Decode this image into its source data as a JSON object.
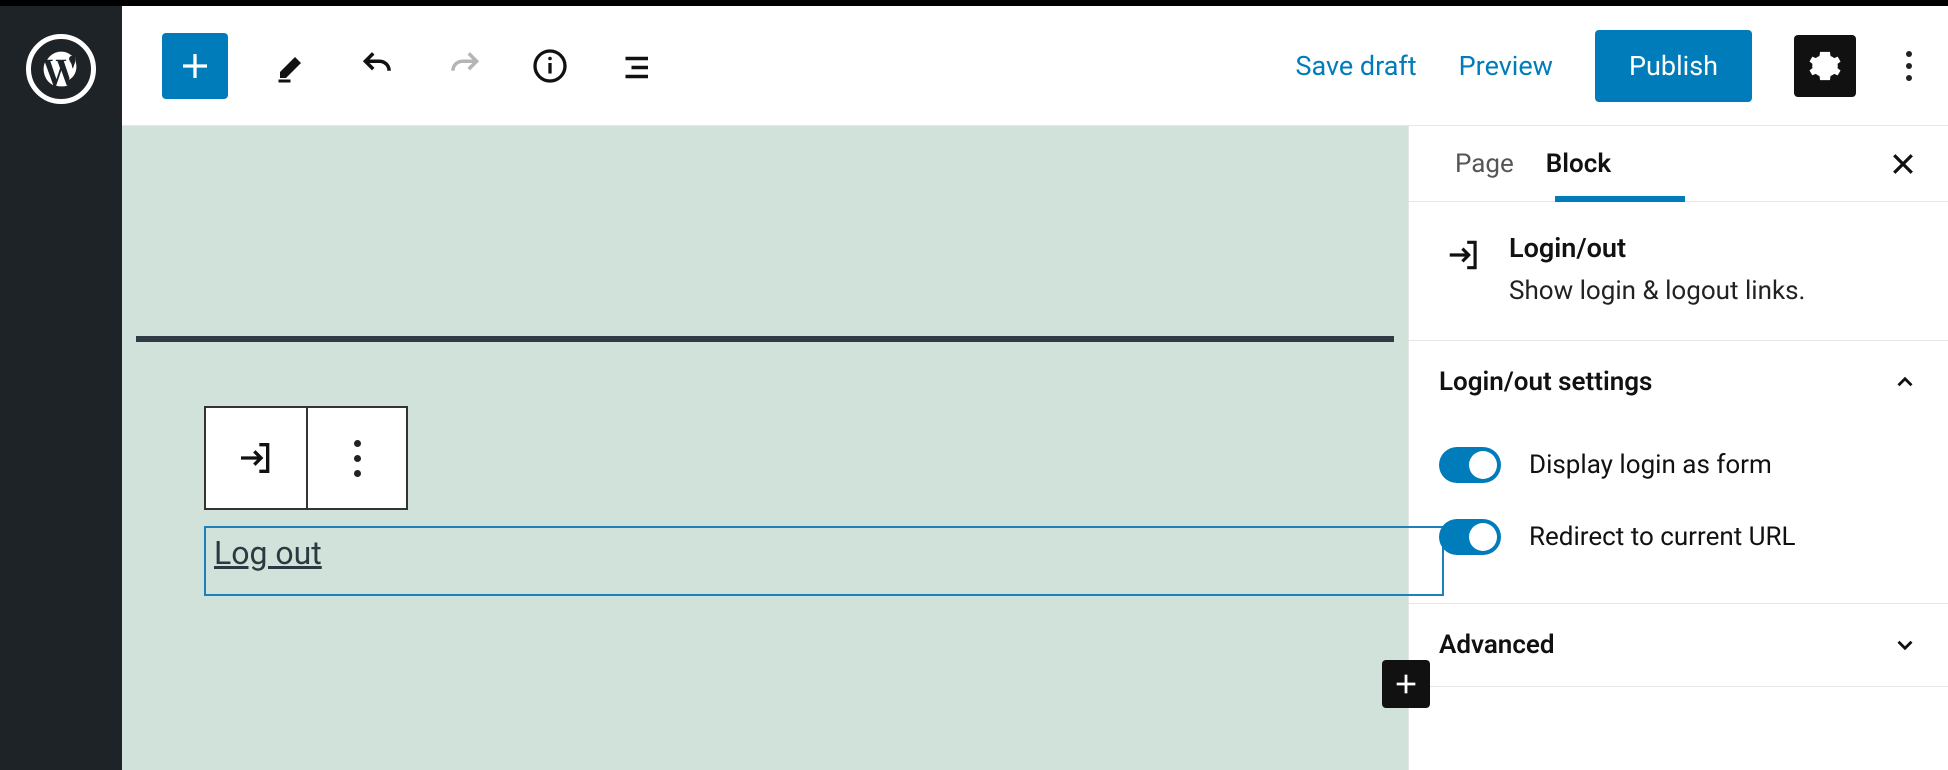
{
  "topbar": {
    "save_draft": "Save draft",
    "preview": "Preview",
    "publish": "Publish"
  },
  "sidebar": {
    "tabs": {
      "page": "Page",
      "block": "Block",
      "active": "block"
    },
    "block": {
      "title": "Login/out",
      "description": "Show login & logout links."
    },
    "settings_panel": {
      "title": "Login/out settings",
      "display_form": "Display login as form",
      "redirect": "Redirect to current URL"
    },
    "advanced_panel": {
      "title": "Advanced"
    }
  },
  "canvas": {
    "selected_text": "Log out"
  }
}
